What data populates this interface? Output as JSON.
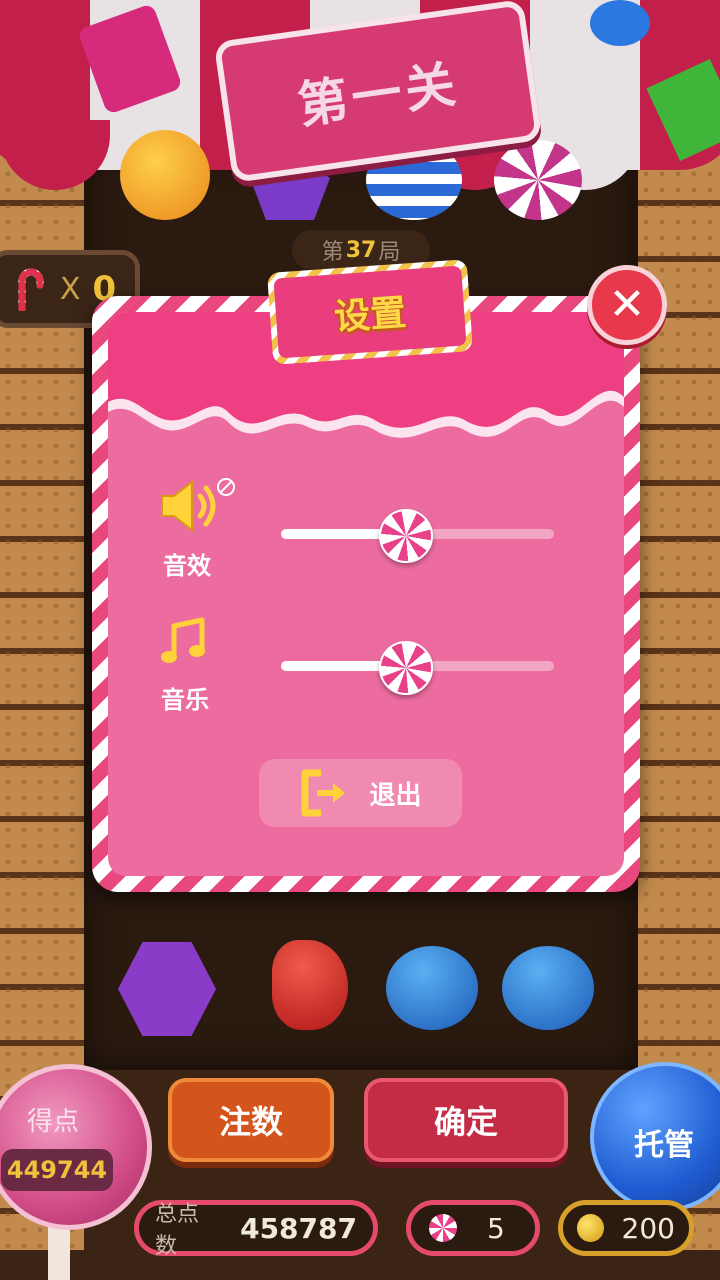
{
  "level_sign": {
    "text": "第一关"
  },
  "round": {
    "prefix": "第",
    "number": "37",
    "suffix": "局"
  },
  "cane_counter": {
    "x": "X",
    "count": "0"
  },
  "settings": {
    "title": "设置",
    "close": "✕",
    "sound_effects": {
      "label": "音效",
      "level": 0.45
    },
    "music": {
      "label": "音乐",
      "level": 0.45
    },
    "exit_label": "退出"
  },
  "hud": {
    "score_label": "得点",
    "score_value": "449744",
    "bet_label": "注数",
    "confirm_label": "确定",
    "auto_label": "托管",
    "total_label": "总点数",
    "total_value": "458787",
    "lollipop_count": "5",
    "coin_count": "200"
  },
  "colors": {
    "dialog_pink": "#ec6ca0",
    "accent_yellow": "#f0c13a",
    "close_red": "#e8384b"
  },
  "icons": [
    "speaker-muted-icon",
    "music-note-icon",
    "exit-door-icon",
    "close-icon",
    "candy-cane-icon",
    "lollipop-icon",
    "coin-icon"
  ]
}
